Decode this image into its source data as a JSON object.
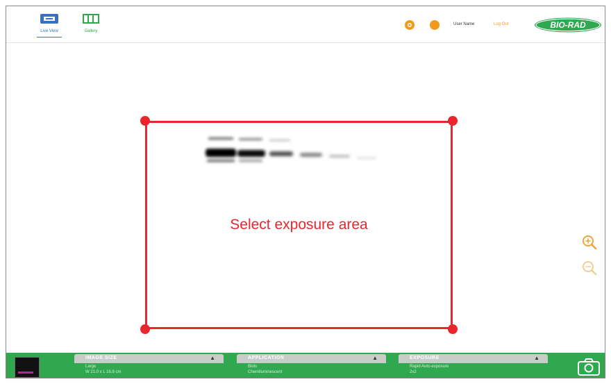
{
  "header": {
    "nav": [
      {
        "label": "Live View",
        "active": true,
        "icon": "live-view-icon"
      },
      {
        "label": "Gallery",
        "active": false,
        "icon": "gallery-icon"
      }
    ],
    "user_name": "User Name",
    "log_out": "Log Out",
    "logo_text": "BIO-RAD"
  },
  "canvas": {
    "selection_prompt": "Select exposure area"
  },
  "footer": {
    "panels": [
      {
        "title": "IMAGE SIZE",
        "line1": "Large",
        "line2": "W 21.0 x L 16.8 cm"
      },
      {
        "title": "APPLICATION",
        "line1": "Blots",
        "line2": "Chemiluminescent"
      },
      {
        "title": "EXPOSURE",
        "line1": "Rapid Auto-exposure",
        "line2": "2x2"
      }
    ]
  },
  "colors": {
    "accent_green": "#2fa84f",
    "selection_red": "#e8262e",
    "icon_orange": "#f29a1e",
    "nav_blue": "#3a6fc1"
  }
}
